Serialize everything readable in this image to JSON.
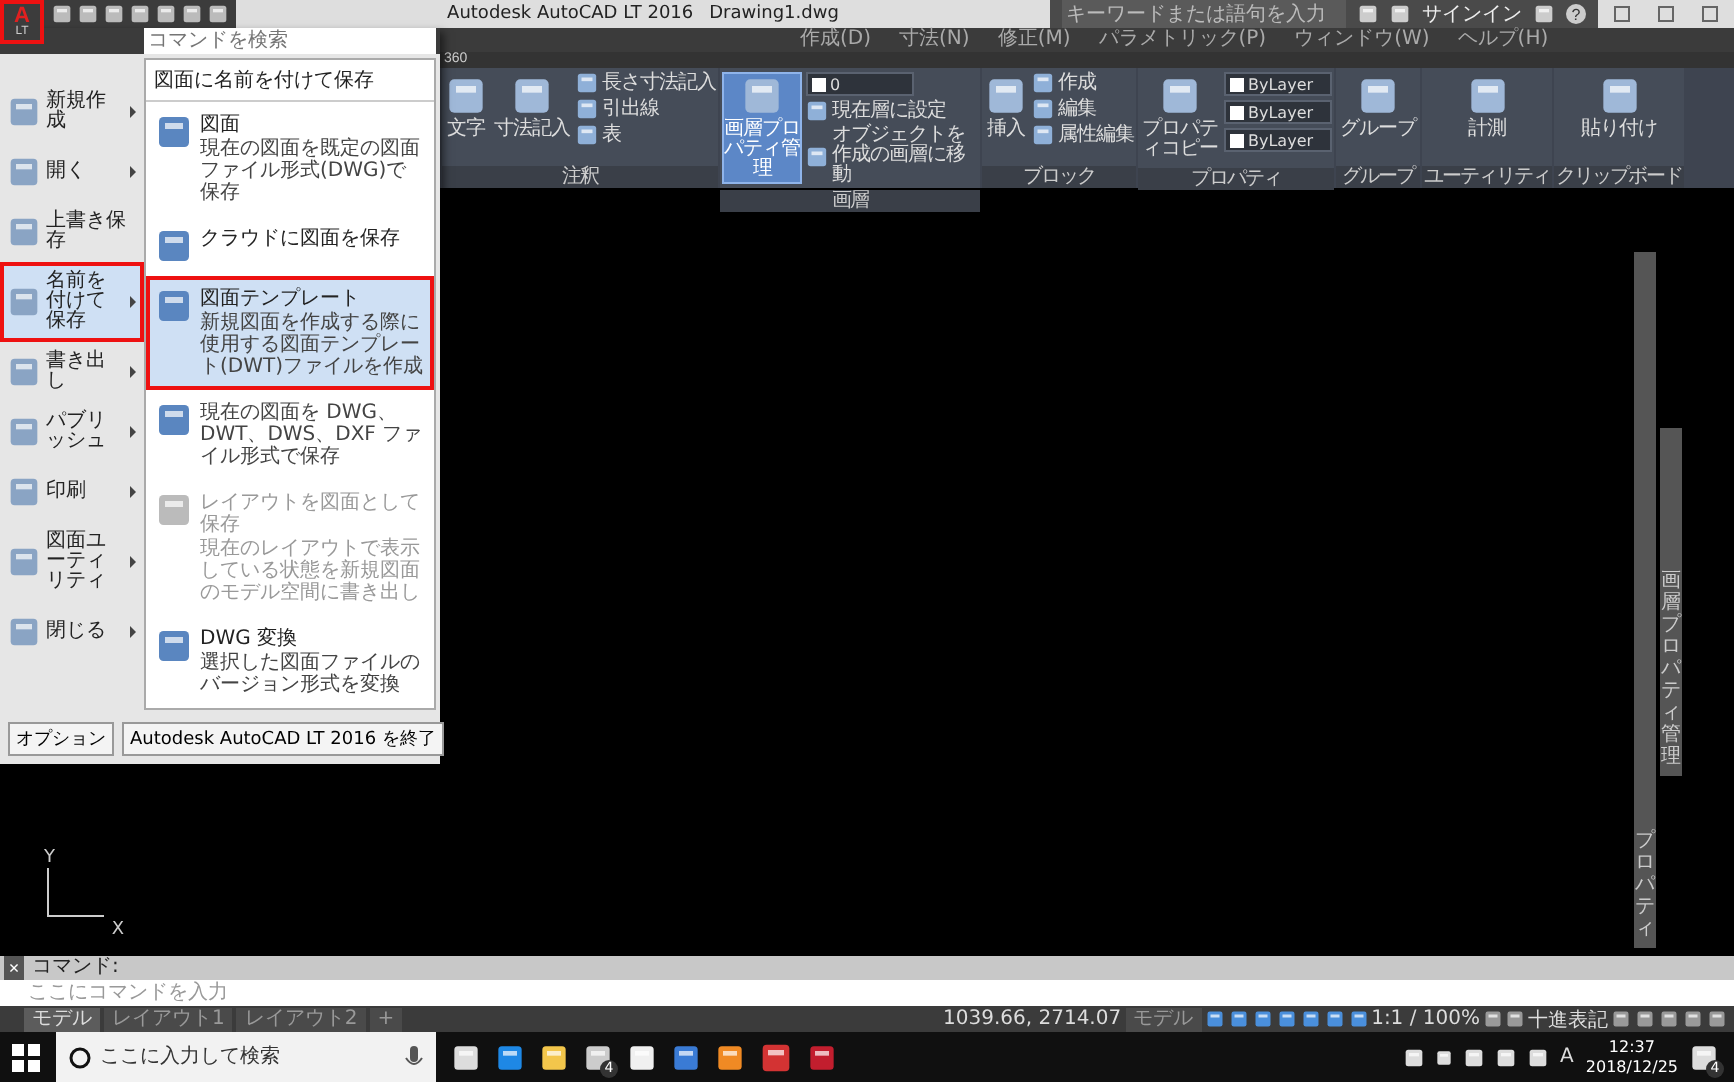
{
  "title_bar": {
    "app_button": {
      "logo": "A",
      "edition": "LT",
      "highlighted": true
    },
    "title": "Autodesk AutoCAD LT 2016",
    "document": "Drawing1.dwg",
    "search": {
      "placeholder": "キーワードまたは語句を入力"
    },
    "sign_in": "サインイン",
    "help": "?"
  },
  "app_menu": {
    "search": {
      "placeholder": "コマンドを検索"
    },
    "items": [
      {
        "label": "新規作成",
        "submenu": true,
        "selected": false,
        "highlighted": false
      },
      {
        "label": "開く",
        "submenu": true,
        "selected": false,
        "highlighted": false
      },
      {
        "label": "上書き保存",
        "submenu": false,
        "selected": false,
        "highlighted": false
      },
      {
        "label": "名前を付けて保存",
        "submenu": true,
        "selected": true,
        "highlighted": true
      },
      {
        "label": "書き出し",
        "submenu": true,
        "selected": false,
        "highlighted": false
      },
      {
        "label": "パブリッシュ",
        "submenu": true,
        "selected": false,
        "highlighted": false
      },
      {
        "label": "印刷",
        "submenu": true,
        "selected": false,
        "highlighted": false
      },
      {
        "label": "図面ユーティリティ",
        "submenu": true,
        "selected": false,
        "highlighted": false
      },
      {
        "label": "閉じる",
        "submenu": true,
        "selected": false,
        "highlighted": false
      }
    ],
    "pane_title": "図面に名前を付けて保存",
    "options": [
      {
        "title": "図面",
        "description": "現在の図面を既定の図面ファイル形式(DWG)で保存",
        "selected": false,
        "highlighted": false,
        "disabled": false
      },
      {
        "title": "クラウドに図面を保存",
        "selected": false,
        "highlighted": false,
        "disabled": false
      },
      {
        "title": "図面テンプレート",
        "description": "新規図面を作成する際に使用する図面テンプレート(DWT)ファイルを作成",
        "selected": true,
        "highlighted": true,
        "disabled": false
      },
      {
        "description": "現在の図面を DWG、DWT、DWS、DXF ファイル形式で保存",
        "selected": false,
        "highlighted": false,
        "disabled": false
      },
      {
        "title": "レイアウトを図面として保存",
        "description": "現在のレイアウトで表示している状態を新規図面のモデル空間に書き出し",
        "selected": false,
        "highlighted": false,
        "disabled": true
      },
      {
        "title": "DWG 変換",
        "description": "選択した図面ファイルのバージョン形式を変換",
        "selected": false,
        "highlighted": false,
        "disabled": false
      }
    ],
    "buttons": [
      "オプション",
      "Autodesk AutoCAD LT 2016 を終了"
    ]
  },
  "menu_bar": {
    "items": [
      "作成(D)",
      "寸法(N)",
      "修正(M)",
      "パラメトリック(P)",
      "ウィンドウ(W)",
      "ヘルプ(H)"
    ]
  },
  "ribbon_tab": "360",
  "ribbon": {
    "panels": [
      {
        "title": "注釈",
        "large": [
          {
            "label": "文字",
            "active": false
          },
          {
            "label": "寸法記入",
            "active": false
          }
        ],
        "small": [
          {
            "kind": "button",
            "label": "長さ寸法記入"
          },
          {
            "kind": "button",
            "label": "引出線"
          },
          {
            "kind": "button",
            "label": "表"
          }
        ]
      },
      {
        "title": "画層",
        "large": [
          {
            "label": "画層プロパティ管理",
            "active": true
          }
        ],
        "small": [
          {
            "kind": "dropdown",
            "label": "0"
          },
          {
            "kind": "button",
            "label": "現在層に設定"
          },
          {
            "kind": "button",
            "label": "オブジェクトを作成の画層に移動"
          }
        ]
      },
      {
        "title": "ブロック",
        "large": [
          {
            "label": "挿入",
            "active": false
          }
        ],
        "small": [
          {
            "kind": "button",
            "label": "作成"
          },
          {
            "kind": "button",
            "label": "編集"
          },
          {
            "kind": "button",
            "label": "属性編集"
          }
        ]
      },
      {
        "title": "プロパティ",
        "large": [
          {
            "label": "プロパティコピー",
            "active": false
          }
        ],
        "small": [
          {
            "kind": "dropdown",
            "label": "ByLayer"
          },
          {
            "kind": "dropdown",
            "label": "ByLayer"
          },
          {
            "kind": "dropdown",
            "label": "ByLayer"
          }
        ]
      },
      {
        "title": "グループ",
        "large": [
          {
            "label": "グループ",
            "active": false
          }
        ]
      },
      {
        "title": "ユーティリティ",
        "large": [
          {
            "label": "計測",
            "active": false
          }
        ]
      },
      {
        "title": "クリップボード",
        "large": [
          {
            "label": "貼り付け",
            "active": false
          }
        ]
      }
    ]
  },
  "palettes": [
    {
      "label": "画層プロパティ管理"
    },
    {
      "label": "プロパティ"
    }
  ],
  "ucs": {
    "x": "X",
    "y": "Y"
  },
  "command_line": {
    "close": "×",
    "label": "コマンド:",
    "input": {
      "placeholder": "ここにコマンドを入力"
    }
  },
  "layout_tabs": [
    {
      "label": "モデル",
      "selected": true
    },
    {
      "label": "レイアウト1",
      "selected": false
    },
    {
      "label": "レイアウト2",
      "selected": false
    },
    {
      "label": "+",
      "selected": false
    }
  ],
  "status_bar": {
    "coordinates": "1039.66, 2714.07",
    "space": "モデル",
    "scale": "1:1 / 100%",
    "units": "十進表記"
  },
  "taskbar": {
    "search": {
      "placeholder": "ここに入力して検索"
    },
    "mail_badge": "4",
    "ime": "A",
    "time": "12:37",
    "date": "2018/12/25",
    "notifications": "4"
  }
}
